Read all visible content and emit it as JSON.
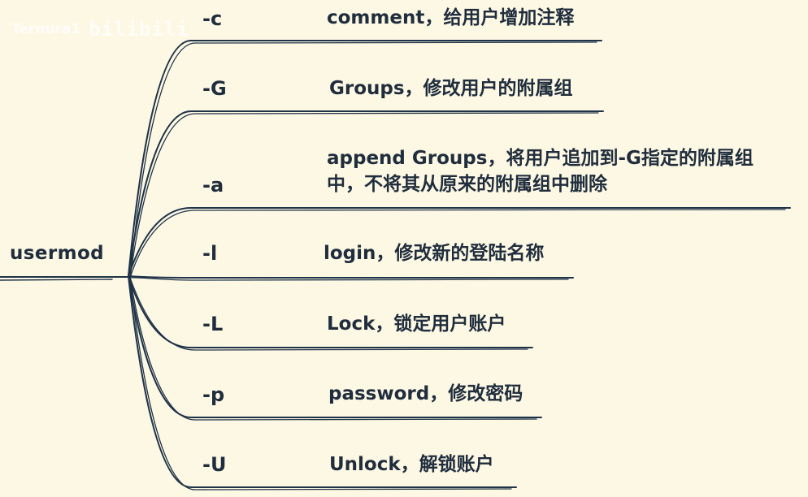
{
  "watermark": {
    "left_text": "Ternura1",
    "right_text": "bilibili"
  },
  "root": {
    "label": "usermod"
  },
  "branches": [
    {
      "option": "-c",
      "description": "comment，给用户增加注释"
    },
    {
      "option": "-G",
      "description": "Groups，修改用户的附属组"
    },
    {
      "option": "-a",
      "description_lines": [
        "append Groups，将用户追加到-G指定的附属组",
        "中，不将其从原来的附属组中删除"
      ]
    },
    {
      "option": "-l",
      "description": "login，修改新的登陆名称"
    },
    {
      "option": "-L",
      "description": "Lock，锁定用户账户"
    },
    {
      "option": "-p",
      "description": "password，修改密码"
    },
    {
      "option": "-U",
      "description": "Unlock，解锁账户"
    }
  ]
}
